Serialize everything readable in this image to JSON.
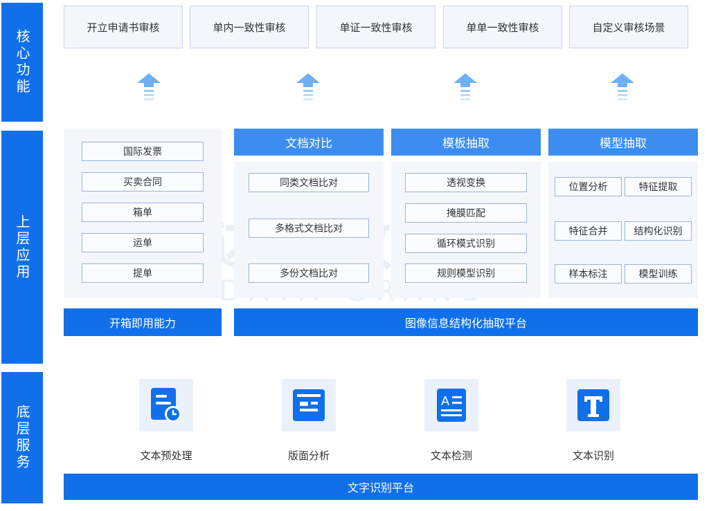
{
  "sides": {
    "core": "核心功能",
    "upper": "上层应用",
    "base": "底层服务"
  },
  "top_boxes": [
    "开立申请书审核",
    "单内一致性审核",
    "单证一致性审核",
    "单单一致性审核",
    "自定义审核场景"
  ],
  "panels": {
    "box": {
      "items": [
        "国际发票",
        "买卖合同",
        "箱单",
        "运单",
        "提单"
      ]
    },
    "doc_compare": {
      "title": "文档对比",
      "items": [
        "同类文档比对",
        "多格式文档比对",
        "多份文档比对"
      ]
    },
    "template": {
      "title": "模板抽取",
      "items": [
        "透视变换",
        "掩膜匹配",
        "循环模式识别",
        "规则模型识别"
      ]
    },
    "model": {
      "title": "模型抽取",
      "items": [
        "位置分析",
        "特征提取",
        "特征合并",
        "结构化识别",
        "样本标注",
        "模型训练"
      ]
    }
  },
  "bars": {
    "box_ability": "开箱即用能力",
    "image_platform": "图像信息结构化抽取平台",
    "ocr_platform": "文字识别平台"
  },
  "services": [
    {
      "label": "文本预处理",
      "icon": "document-clock-icon"
    },
    {
      "label": "版面分析",
      "icon": "layout-icon"
    },
    {
      "label": "文本检测",
      "icon": "text-detect-icon"
    },
    {
      "label": "文本识别",
      "icon": "text-t-icon"
    }
  ],
  "watermark": {
    "cn": "达观数据",
    "en": "DATA GRAND"
  },
  "colors": {
    "primary": "#1170e9",
    "panel_head": "#3d8df0",
    "arrow": "#6fb0f5"
  }
}
